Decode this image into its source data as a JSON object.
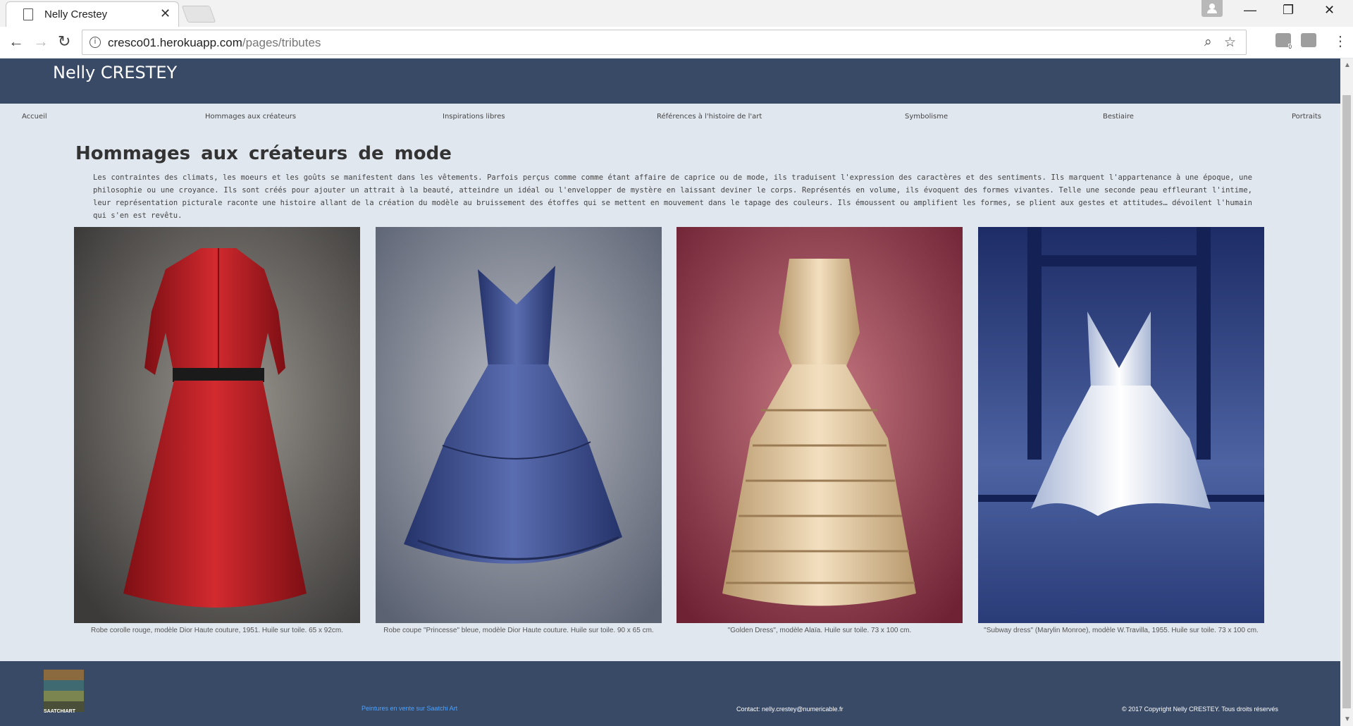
{
  "browser": {
    "tab_title": "Nelly Crestey",
    "tab_close": "✕",
    "url_host": "cresco01.herokuapp.com",
    "url_path": "/pages/tributes",
    "ext_badge": "0"
  },
  "site": {
    "title": "Nelly CRESTEY"
  },
  "nav": {
    "items": [
      "Accueil",
      "Hommages aux créateurs",
      "Inspirations libres",
      "Références à l'histoire de l'art",
      "Symbolisme",
      "Bestiaire",
      "Portraits"
    ]
  },
  "main": {
    "title": "Hommages aux créateurs de mode",
    "intro": "Les contraintes des climats, les moeurs et les goûts se manifestent dans les vêtements. Parfois perçus comme comme étant affaire de caprice ou de mode, ils traduisent l'expression des caractères et des sentiments. Ils marquent l'appartenance à une époque, une philosophie ou une croyance. Ils sont créés pour ajouter un attrait à la beauté, atteindre un idéal ou l'envelopper de mystère en laissant deviner le corps. Représentés en volume, ils évoquent des formes vivantes. Telle une seconde peau effleurant l'intime, leur représentation picturale raconte une histoire allant de la création du modèle au bruissement des étoffes qui se mettent en mouvement dans le tapage des couleurs. Ils émoussent ou amplifient les formes, se plient aux gestes et attitudes… dévoilent l'humain qui s'en est revêtu."
  },
  "paintings": [
    {
      "caption": "Robe corolle rouge, modèle Dior Haute couture, 1951. Huile sur toile. 65 x 92cm.",
      "bg": "#6e6a66",
      "dress": "#c01d22"
    },
    {
      "caption": "Robe coupe \"Princesse\" bleue, modèle Dior Haute couture. Huile sur toile. 90 x 65 cm.",
      "bg": "#7e8797",
      "dress": "#3d4f8e"
    },
    {
      "caption": "\"Golden Dress\", modèle Alaïa. Huile sur toile. 73 x 100 cm.",
      "bg": "#9a3c4e",
      "dress": "#e8cfa8"
    },
    {
      "caption": "\"Subway dress\" (Marylin Monroe), modèle W.Travilla, 1955. Huile sur toile. 73 x 100 cm.",
      "bg": "#2b3d7a",
      "dress": "#e9eef7"
    }
  ],
  "footer": {
    "logo_label": "SAATCHIART",
    "saatchi_link": "Peintures en vente sur Saatchi Art",
    "contact": "Contact: nelly.crestey@numericable.fr",
    "copyright": "© 2017 Copyright Nelly CRESTEY. Tous droits réservés"
  }
}
